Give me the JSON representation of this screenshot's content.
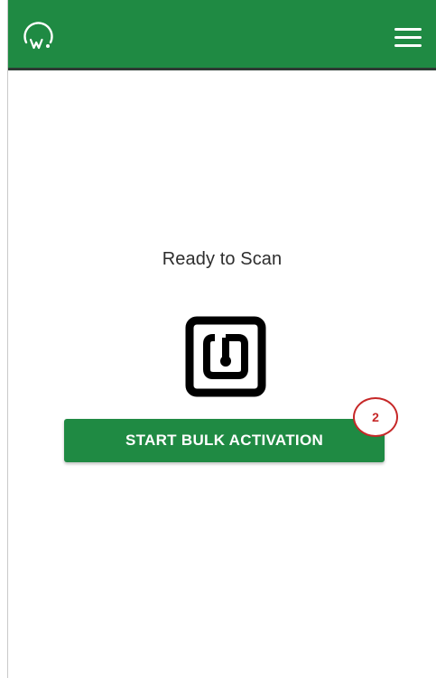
{
  "colors": {
    "brand_green": "#1f8a43",
    "marker_red": "#c62828",
    "text_dark": "#2d2d2d"
  },
  "header": {
    "logo_icon": "w-arc-logo-icon",
    "menu_icon": "hamburger-menu-icon"
  },
  "main": {
    "status_text": "Ready to Scan",
    "scan_icon": "nfc-tag-icon",
    "start_button_label": "START BULK ACTIVATION",
    "step_marker": "2"
  }
}
